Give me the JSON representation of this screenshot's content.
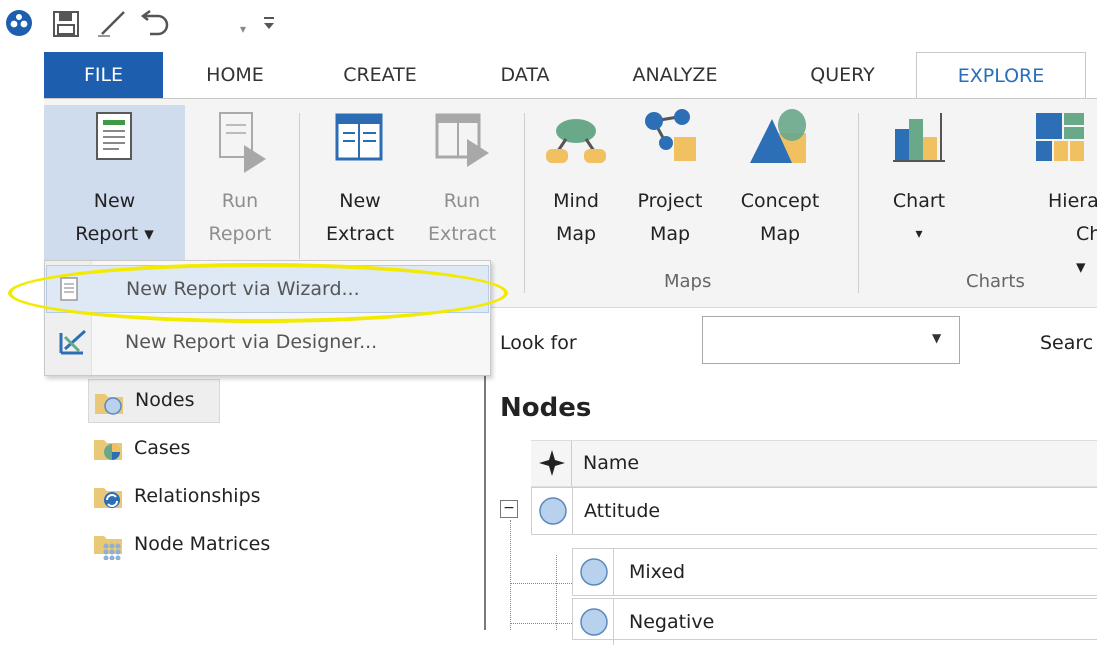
{
  "quick_access": {
    "icons": [
      "app-logo-icon",
      "save-icon",
      "edit-icon",
      "undo-icon",
      "undo-dropdown-icon",
      "customize-qat-icon"
    ]
  },
  "tabs": [
    {
      "label": "FILE"
    },
    {
      "label": "HOME"
    },
    {
      "label": "CREATE"
    },
    {
      "label": "DATA"
    },
    {
      "label": "ANALYZE"
    },
    {
      "label": "QUERY"
    },
    {
      "label": "EXPLORE"
    }
  ],
  "ribbon": {
    "new_report": {
      "line1": "New",
      "line2": "Report ▾"
    },
    "run_report": {
      "line1": "Run",
      "line2": "Report"
    },
    "new_extract": {
      "line1": "New",
      "line2": "Extract"
    },
    "run_extract": {
      "line1": "Run",
      "line2": "Extract"
    },
    "mind_map": {
      "line1": "Mind",
      "line2": "Map"
    },
    "project_map": {
      "line1": "Project",
      "line2": "Map"
    },
    "concept_map": {
      "line1": "Concept",
      "line2": "Map"
    },
    "chart": {
      "line1": "Chart",
      "line2": "▾"
    },
    "hierarchy_chart": {
      "line1": "Hierarch",
      "line2": "Chart ▾"
    },
    "groups": {
      "maps": "Maps",
      "charts": "Charts"
    }
  },
  "dropdown": {
    "items": [
      {
        "label": "New Report via Wizard..."
      },
      {
        "label": "New Report via Designer..."
      }
    ]
  },
  "search": {
    "look_for_label": "Look for",
    "look_for_value": "",
    "search_label": "Searc"
  },
  "nav": {
    "items": [
      {
        "label": "Nodes"
      },
      {
        "label": "Cases"
      },
      {
        "label": "Relationships"
      },
      {
        "label": "Node Matrices"
      }
    ]
  },
  "list": {
    "title": "Nodes",
    "column_name": "Name",
    "rows": [
      {
        "label": "Attitude"
      },
      {
        "label": "Mixed"
      },
      {
        "label": "Negative"
      }
    ]
  },
  "colors": {
    "file_tab": "#1d5fae",
    "explore_tab_text": "#2a6ebb",
    "highlight": "#f2ea00",
    "node_circle": "#b8d1ec"
  }
}
